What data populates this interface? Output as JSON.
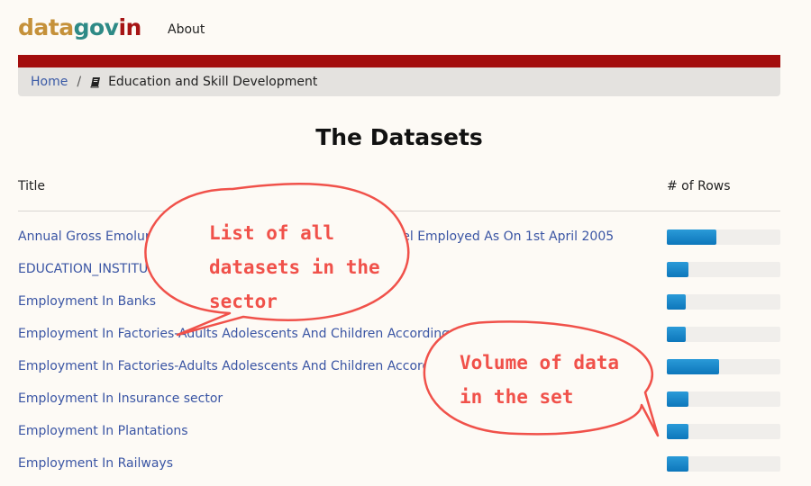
{
  "header": {
    "brand_part1": "data",
    "brand_part2": "gov",
    "brand_part3": "in",
    "about_label": "About"
  },
  "breadcrumb": {
    "home_label": "Home",
    "separator": "/",
    "current_label": "Education and Skill Development"
  },
  "main": {
    "title": "The Datasets",
    "columns": {
      "title": "Title",
      "rows": "# of Rows"
    },
    "datasets": [
      {
        "title": "Annual Gross Emoluments Payable Per Annum To All Personnel Employed As On 1st April 2005",
        "rows_fraction": 0.44
      },
      {
        "title": "EDUCATION_INSTITUTIONS",
        "rows_fraction": 0.19
      },
      {
        "title": "Employment In Banks",
        "rows_fraction": 0.17
      },
      {
        "title": "Employment In Factories-Adults Adolescents And Children According To Sex",
        "rows_fraction": 0.17
      },
      {
        "title": "Employment In Factories-Adults Adolescents And Children According To Sex",
        "rows_fraction": 0.46
      },
      {
        "title": "Employment In Insurance sector",
        "rows_fraction": 0.19
      },
      {
        "title": "Employment In Plantations",
        "rows_fraction": 0.19
      },
      {
        "title": "Employment In Railways",
        "rows_fraction": 0.19
      }
    ]
  },
  "callouts": {
    "list_line1": "List of all",
    "list_line2": "datasets in the",
    "list_line3": "sector",
    "volume_line1": "Volume of data",
    "volume_line2": "in the set"
  },
  "colors": {
    "accent_bar": "#a30d0d",
    "link": "#3a55a4",
    "row_bar": "#0d77bb",
    "callout": "#f0514a"
  },
  "icons": {
    "breadcrumb_icon": "book-icon"
  }
}
